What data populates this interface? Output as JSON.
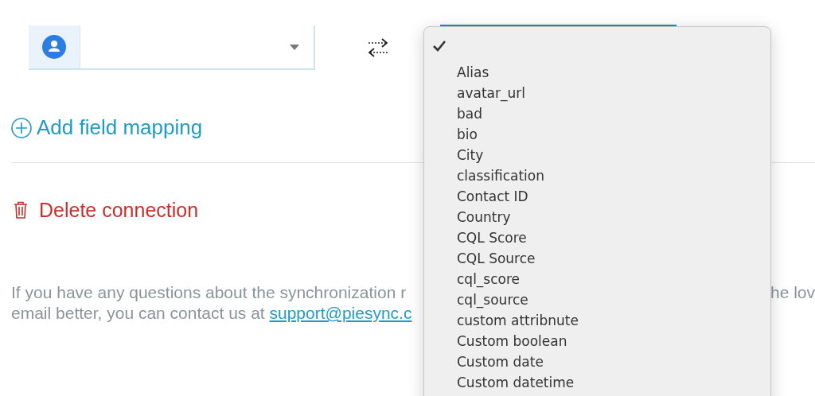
{
  "add_mapping": {
    "label": "Add field mapping"
  },
  "delete_connection": {
    "label": "Delete connection"
  },
  "help_text": {
    "line_1": "If you have any questions about the synchronization r",
    "line_2": "email better, you can contact us at ",
    "link": "support@piesync.c",
    "right_fragment": "he lov"
  },
  "dropdown_menu": {
    "items": [
      {
        "selected": true
      },
      {
        "label": "Alias",
        "selected": false
      },
      {
        "label": "avatar_url",
        "selected": false
      },
      {
        "label": "bad",
        "selected": false
      },
      {
        "label": "bio",
        "selected": false
      },
      {
        "label": "City",
        "selected": false
      },
      {
        "label": "classification",
        "selected": false
      },
      {
        "label": "Contact ID",
        "selected": false
      },
      {
        "label": "Country",
        "selected": false
      },
      {
        "label": "CQL Score",
        "selected": false
      },
      {
        "label": "CQL Source",
        "selected": false
      },
      {
        "label": "cql_score",
        "selected": false
      },
      {
        "label": "cql_source",
        "selected": false
      },
      {
        "label": "custom attribnute",
        "selected": false
      },
      {
        "label": "Custom boolean",
        "selected": false
      },
      {
        "label": "Custom date",
        "selected": false
      },
      {
        "label": "Custom datetime",
        "selected": false
      }
    ]
  }
}
